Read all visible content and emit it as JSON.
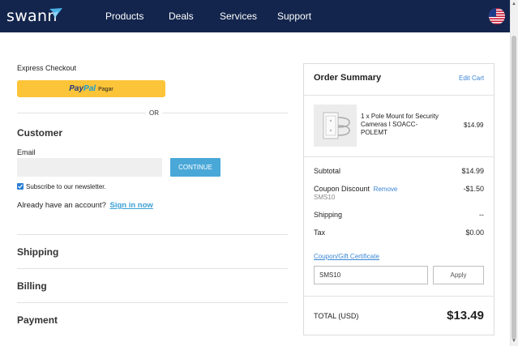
{
  "header": {
    "logo": "swann",
    "nav": [
      "Products",
      "Deals",
      "Services",
      "Support"
    ],
    "flag_icon": "us-flag-icon",
    "background_color": "#13254d"
  },
  "express": {
    "label": "Express Checkout",
    "paypal_part1": "Pay",
    "paypal_part2": "Pal",
    "paypal_suffix": "Pagar",
    "button_color": "#fcc439",
    "or": "OR"
  },
  "customer": {
    "heading": "Customer",
    "email_label": "Email",
    "email_value": "",
    "continue": "CONTINUE",
    "subscribe_checked": true,
    "subscribe_label": "Subscribe to our newsletter.",
    "account_prompt": "Already have an account?",
    "sign_in": "Sign in now"
  },
  "sections": [
    "Shipping",
    "Billing",
    "Payment"
  ],
  "summary": {
    "title": "Order Summary",
    "edit_cart": "Edit Cart",
    "product": {
      "name": "1 x Pole Mount for Security Cameras I SOACC-POLEMT",
      "price": "$14.99",
      "image_icon": "pole-mount-icon"
    },
    "subtotal_label": "Subtotal",
    "subtotal_value": "$14.99",
    "coupon_label": "Coupon Discount",
    "coupon_remove": "Remove",
    "coupon_code": "SMS10",
    "coupon_value": "-$1.50",
    "shipping_label": "Shipping",
    "shipping_value": "--",
    "tax_label": "Tax",
    "tax_value": "$0.00",
    "coupon_link": "Coupon/Gift Certificate",
    "coupon_input_value": "SMS10",
    "apply": "Apply",
    "total_label": "TOTAL (USD)",
    "total_value": "$13.49"
  },
  "accent_color": "#4aa8d8"
}
